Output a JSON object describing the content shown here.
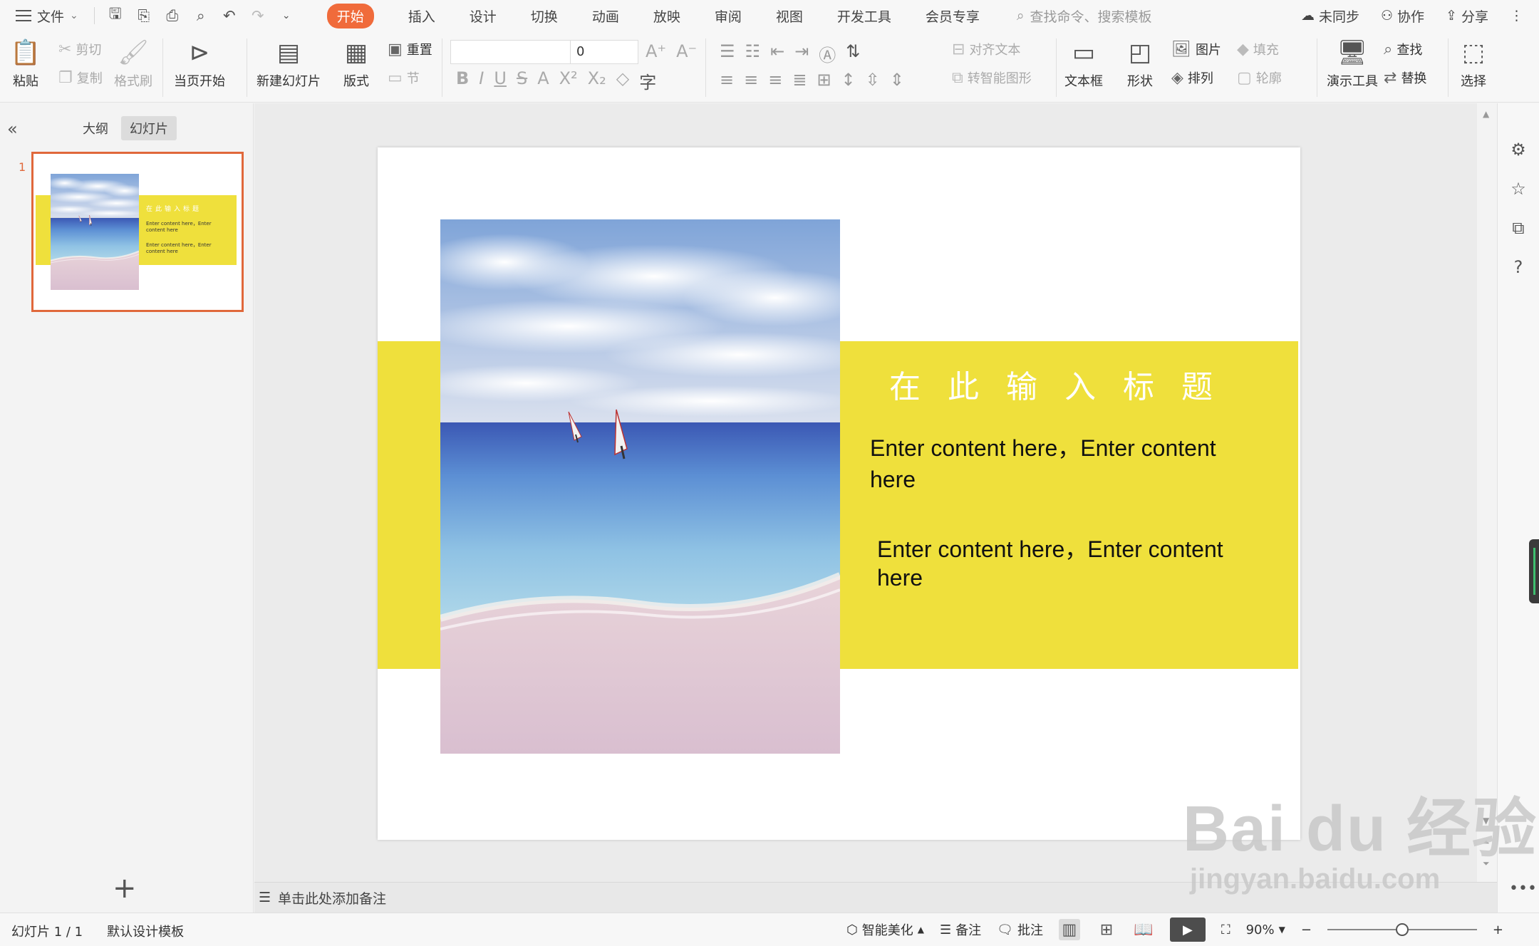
{
  "menubar": {
    "file": "文件",
    "tabs": [
      "开始",
      "插入",
      "设计",
      "切换",
      "动画",
      "放映",
      "审阅",
      "视图",
      "开发工具",
      "会员专享"
    ],
    "active_tab": "开始",
    "search_placeholder": "查找命令、搜索模板",
    "sync": "未同步",
    "collab": "协作",
    "share": "分享"
  },
  "ribbon": {
    "paste": "粘贴",
    "cut": "剪切",
    "copy": "复制",
    "format_painter": "格式刷",
    "from_current": "当页开始",
    "new_slide": "新建幻灯片",
    "layout": "版式",
    "reset": "重置",
    "section": "节",
    "font_size": "0",
    "align_text": "对齐文本",
    "smartart": "转智能图形",
    "textbox": "文本框",
    "shape": "形状",
    "picture": "图片",
    "arrange": "排列",
    "fill": "填充",
    "outline": "轮廓",
    "presentation_tools": "演示工具",
    "find": "查找",
    "replace": "替换",
    "select": "选择"
  },
  "left_panel": {
    "tab_outline": "大纲",
    "tab_slides": "幻灯片",
    "slide_number": "1"
  },
  "slide": {
    "title": "在此输入标题",
    "text1": "Enter content here，Enter content here",
    "text2": "Enter content here，Enter content here",
    "band_color": "#efe03c"
  },
  "notes": {
    "placeholder": "单击此处添加备注"
  },
  "status": {
    "slide_info": "幻灯片 1 / 1",
    "template": "默认设计模板",
    "beautify": "智能美化",
    "notes": "备注",
    "comments": "批注",
    "zoom": "90%",
    "zoom_level": 0.5
  },
  "watermark": {
    "text1": "Bai du 经验",
    "text2": "jingyan.baidu.com"
  }
}
